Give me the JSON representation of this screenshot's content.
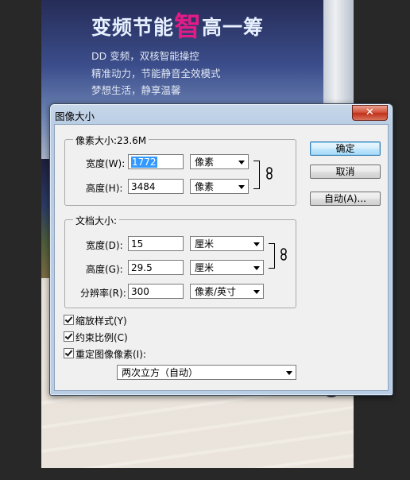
{
  "poster": {
    "headline_pre": "变频节能",
    "headline_accent": "智",
    "headline_post": "高一筹",
    "sub_lines": [
      "DD 变频，双核智能操控",
      "精准动力，节能静音全效模式",
      "梦想生活，静享温馨"
    ]
  },
  "dialog": {
    "title": "图像大小",
    "close_glyph": "✕",
    "pixel_group": {
      "label": "像素大小:23.6M",
      "width_label": "宽度(W):",
      "width_value": "1772",
      "width_unit": "像素",
      "height_label": "高度(H):",
      "height_value": "3484",
      "height_unit": "像素"
    },
    "doc_group": {
      "label": "文档大小:",
      "width_label": "宽度(D):",
      "width_value": "15",
      "width_unit": "厘米",
      "height_label": "高度(G):",
      "height_value": "29.5",
      "height_unit": "厘米",
      "res_label": "分辨率(R):",
      "res_value": "300",
      "res_unit": "像素/英寸"
    },
    "options": {
      "scale_styles": "缩放样式(Y)",
      "constrain": "约束比例(C)",
      "resample": "重定图像像素(I):",
      "resample_method": "两次立方（自动）"
    },
    "buttons": {
      "ok": "确定",
      "cancel": "取消",
      "auto": "自动(A)..."
    }
  }
}
